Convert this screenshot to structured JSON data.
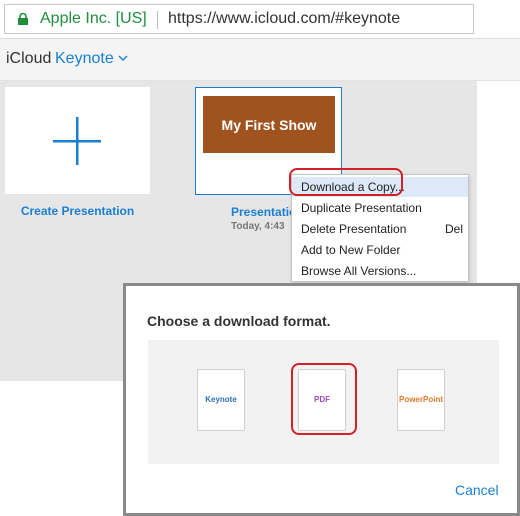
{
  "browser": {
    "site_name": "Apple Inc. [US]",
    "url": "https://www.icloud.com/#keynote"
  },
  "app_bar": {
    "brand": "iCloud",
    "app_name": "Keynote"
  },
  "gallery": {
    "create_label": "Create Presentation",
    "document": {
      "thumbnail_title": "My First Show",
      "label": "Presentatio",
      "date": "Today, 4:43"
    }
  },
  "context_menu": {
    "items": [
      {
        "label": "Download a Copy...",
        "shortcut": ""
      },
      {
        "label": "Duplicate Presentation",
        "shortcut": ""
      },
      {
        "label": "Delete Presentation",
        "shortcut": "Del"
      },
      {
        "label": "Add to New Folder",
        "shortcut": ""
      },
      {
        "label": "Browse All Versions...",
        "shortcut": ""
      }
    ],
    "highlighted_index": 0
  },
  "dialog": {
    "title": "Choose a download format.",
    "formats": [
      "Keynote",
      "PDF",
      "PowerPoint"
    ],
    "cancel_label": "Cancel"
  },
  "colors": {
    "accent": "#1a7fd4",
    "annotation_ring": "#d0202a",
    "thumbnail_bg": "#a0531f",
    "secure_green": "#1e8e3e"
  }
}
